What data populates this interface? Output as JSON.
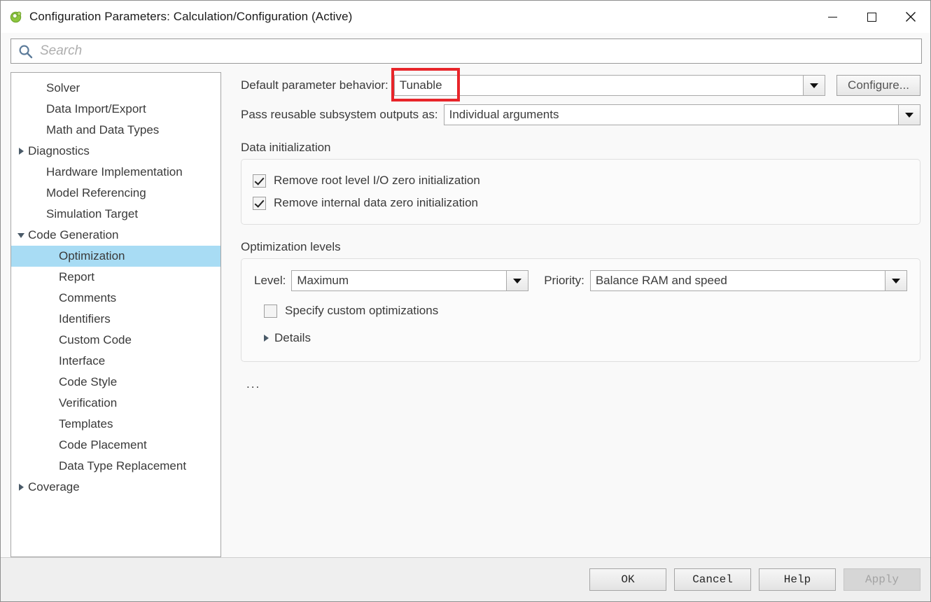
{
  "window": {
    "title": "Configuration Parameters: Calculation/Configuration (Active)",
    "app_icon": "simulink-icon",
    "minimize_label": "minimize-icon",
    "maximize_label": "maximize-icon",
    "close_label": "close-icon"
  },
  "search": {
    "icon": "search-icon",
    "placeholder": "Search",
    "value": ""
  },
  "tree": {
    "items": [
      {
        "label": "Solver",
        "indent": 1,
        "twisty": "none",
        "selected": false
      },
      {
        "label": "Data Import/Export",
        "indent": 1,
        "twisty": "none",
        "selected": false
      },
      {
        "label": "Math and Data Types",
        "indent": 1,
        "twisty": "none",
        "selected": false
      },
      {
        "label": "Diagnostics",
        "indent": 0,
        "twisty": "collapsed",
        "selected": false
      },
      {
        "label": "Hardware Implementation",
        "indent": 1,
        "twisty": "none",
        "selected": false
      },
      {
        "label": "Model Referencing",
        "indent": 1,
        "twisty": "none",
        "selected": false
      },
      {
        "label": "Simulation Target",
        "indent": 1,
        "twisty": "none",
        "selected": false
      },
      {
        "label": "Code Generation",
        "indent": 0,
        "twisty": "expanded",
        "selected": false
      },
      {
        "label": "Optimization",
        "indent": 2,
        "twisty": "none",
        "selected": true
      },
      {
        "label": "Report",
        "indent": 2,
        "twisty": "none",
        "selected": false
      },
      {
        "label": "Comments",
        "indent": 2,
        "twisty": "none",
        "selected": false
      },
      {
        "label": "Identifiers",
        "indent": 2,
        "twisty": "none",
        "selected": false
      },
      {
        "label": "Custom Code",
        "indent": 2,
        "twisty": "none",
        "selected": false
      },
      {
        "label": "Interface",
        "indent": 2,
        "twisty": "none",
        "selected": false
      },
      {
        "label": "Code Style",
        "indent": 2,
        "twisty": "none",
        "selected": false
      },
      {
        "label": "Verification",
        "indent": 2,
        "twisty": "none",
        "selected": false
      },
      {
        "label": "Templates",
        "indent": 2,
        "twisty": "none",
        "selected": false
      },
      {
        "label": "Code Placement",
        "indent": 2,
        "twisty": "none",
        "selected": false
      },
      {
        "label": "Data Type Replacement",
        "indent": 2,
        "twisty": "none",
        "selected": false
      },
      {
        "label": "Coverage",
        "indent": 0,
        "twisty": "collapsed",
        "selected": false
      }
    ]
  },
  "pane": {
    "default_parameter_behavior": {
      "label": "Default parameter behavior:",
      "value": "Tunable",
      "highlighted": true,
      "highlight_color": "#e8252a",
      "configure_button": "Configure..."
    },
    "pass_reusable": {
      "label": "Pass reusable subsystem outputs as:",
      "value": "Individual arguments"
    },
    "data_initialization": {
      "title": "Data initialization",
      "checkboxes": [
        {
          "label": "Remove root level I/O zero initialization",
          "checked": true
        },
        {
          "label": "Remove internal data zero initialization",
          "checked": true
        }
      ]
    },
    "optimization_levels": {
      "title": "Optimization levels",
      "level_label": "Level:",
      "level_value": "Maximum",
      "priority_label": "Priority:",
      "priority_value": "Balance RAM and speed",
      "custom_checkbox": {
        "label": "Specify custom optimizations",
        "checked": false
      },
      "details_label": "Details",
      "details_expanded": false
    },
    "overflow_text": "..."
  },
  "footer": {
    "buttons": [
      {
        "label": "OK",
        "disabled": false
      },
      {
        "label": "Cancel",
        "disabled": false
      },
      {
        "label": "Help",
        "disabled": false
      },
      {
        "label": "Apply",
        "disabled": true
      }
    ]
  }
}
